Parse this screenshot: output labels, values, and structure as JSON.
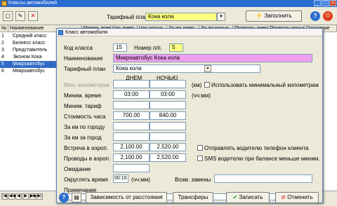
{
  "window": {
    "title": "Классы автомобилей",
    "min": "_",
    "max": "□",
    "close": "×"
  },
  "toolbar": {
    "tariff_label": "Тарифный план",
    "tariff_value": "Кока кола",
    "fill_button": "Заполнить",
    "help": "?"
  },
  "grid": {
    "headers": [
      "№",
      "Наименование",
      "Миним. время",
      "Час днем",
      "Час ночью",
      "За км днем",
      "За км ночью",
      "Проводы днем",
      "Проводы ночью",
      "Ожидание"
    ],
    "rows": [
      {
        "num": "1",
        "name": "Средний класс"
      },
      {
        "num": "2",
        "name": "Бизнесс класс"
      },
      {
        "num": "3",
        "name": "Представитель"
      },
      {
        "num": "4",
        "name": "Эконом Кока"
      },
      {
        "num": "5",
        "name": "Микроавтобус"
      },
      {
        "num": "6",
        "name": "Микроавтобус"
      }
    ]
  },
  "dialog": {
    "title": "Класс автомобиля",
    "code_label": "Код класса",
    "code_value": "15",
    "order_label": "Номер п/п.",
    "order_value": "5",
    "name_label": "Наименование",
    "name_value": "Микроавтобус Кока кола",
    "tariff_label": "Тарифный план",
    "tariff_value": "Кока кола",
    "col_day": "ДНЕМ",
    "col_night": "НОЧЬЮ",
    "rows": [
      {
        "label": "Мин. километраж",
        "day": "",
        "night": "",
        "unit": "(км)",
        "disabled": true
      },
      {
        "label": "Миним. время",
        "day": "03:00",
        "night": "03:00",
        "unit": "(чч:мм)"
      },
      {
        "label": "Миним. тариф",
        "day": "",
        "night": "",
        "unit": ""
      },
      {
        "label": "Стоимость часа",
        "day": "700.00",
        "night": "840.00",
        "unit": ""
      },
      {
        "label": "За км по городу",
        "day": "",
        "night": "",
        "unit": ""
      },
      {
        "label": "За км за город",
        "day": "",
        "night": "",
        "unit": ""
      },
      {
        "label": "Встреча в аэроп.",
        "day": "2,100.00",
        "night": "2,520.00",
        "unit": ""
      },
      {
        "label": "Проводы в аэроп.",
        "day": "2,100.00",
        "night": "2,520.00",
        "unit": ""
      }
    ],
    "use_min_km": "Использовать минимальный километраж",
    "send_phone": "Отправлять водителю телефон клиента",
    "sms_balance": "SMS водителю при балансе меньше миним.",
    "wait_label": "Ожидание",
    "round_label": "Округлять время",
    "round_value": "00:15",
    "round_unit": "(чч:мм)",
    "replace_label": "Возм. замены",
    "note_label": "Примечание"
  },
  "bottom": {
    "distance_button": "Зависимость от расстояния",
    "transfers_button": "Трансферы",
    "save_button": "Записать",
    "cancel_button": "Отменить",
    "help": "?"
  }
}
